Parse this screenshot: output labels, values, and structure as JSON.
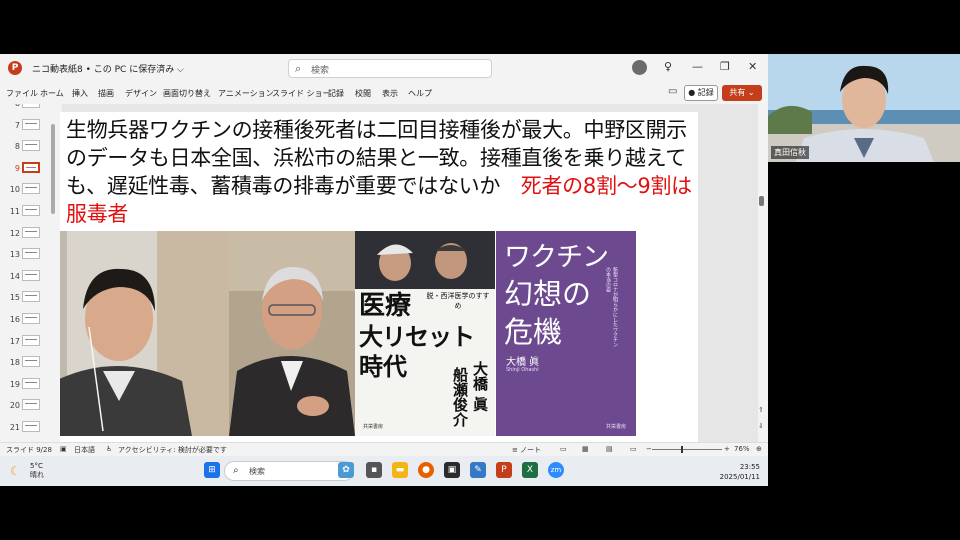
{
  "window": {
    "file_title": "ニコ動表紙8 • この PC に保存済み ⌵",
    "search_placeholder": "検索",
    "record_label": "記録",
    "share_label": "共有 ⌄"
  },
  "menu": [
    "ファイル",
    "ホーム",
    "挿入",
    "描画",
    "デザイン",
    "画面切り替え",
    "アニメーション",
    "スライド ショー",
    "記録",
    "校閲",
    "表示",
    "ヘルプ"
  ],
  "thumbnails": [
    {
      "num": "6",
      "selected": false
    },
    {
      "num": "7",
      "selected": false
    },
    {
      "num": "8",
      "selected": false
    },
    {
      "num": "9",
      "selected": true
    },
    {
      "num": "10",
      "selected": false
    },
    {
      "num": "11",
      "selected": false
    },
    {
      "num": "12",
      "selected": false
    },
    {
      "num": "13",
      "selected": false
    },
    {
      "num": "14",
      "selected": false
    },
    {
      "num": "15",
      "selected": false
    },
    {
      "num": "16",
      "selected": false
    },
    {
      "num": "17",
      "selected": false
    },
    {
      "num": "18",
      "selected": false
    },
    {
      "num": "19",
      "selected": false
    },
    {
      "num": "20",
      "selected": false
    },
    {
      "num": "21",
      "selected": false
    }
  ],
  "slide": {
    "title_black": "生物兵器ワクチンの接種後死者は二回目接種後が最大。中野区開示のデータも日本全国、浜松市の結果と一致。接種直後を乗り越えても、遅延性毒、蓄積毒の排毒が重要ではないか　",
    "title_red": "死者の8割〜9割は服毒者",
    "book1": {
      "subtitle": "脱・西洋医学のすすめ",
      "title_line1": "医療",
      "title_line2": "大リセット",
      "title_line3": "時代",
      "author1": "大橋 眞",
      "author2": "船瀬俊介",
      "publisher": "共栄書房"
    },
    "book2": {
      "title_line1": "ワクチン",
      "title_line2": "幻想の",
      "title_line3": "危機",
      "side_text": "新型コロナが明らかにしたワクチンの本当の姿",
      "author": "大橋 眞",
      "author_en": "Shinji Ohashi",
      "publisher": "共栄書房"
    }
  },
  "statusbar": {
    "slide_count": "スライド 9/28",
    "language": "日本語",
    "accessibility": "アクセシビリティ: 検討が必要です",
    "notes": "ノート",
    "zoom": "76%"
  },
  "taskbar": {
    "weather_temp": "5°C",
    "weather_desc": "晴れ",
    "search_label": "検索",
    "time": "23:55",
    "date": "2025/01/11"
  },
  "webcam": {
    "name": "真田信秋"
  },
  "colors": {
    "accent": "#c43e1c",
    "title_red": "#e01010",
    "book2_purple": "#6d4a8f"
  }
}
